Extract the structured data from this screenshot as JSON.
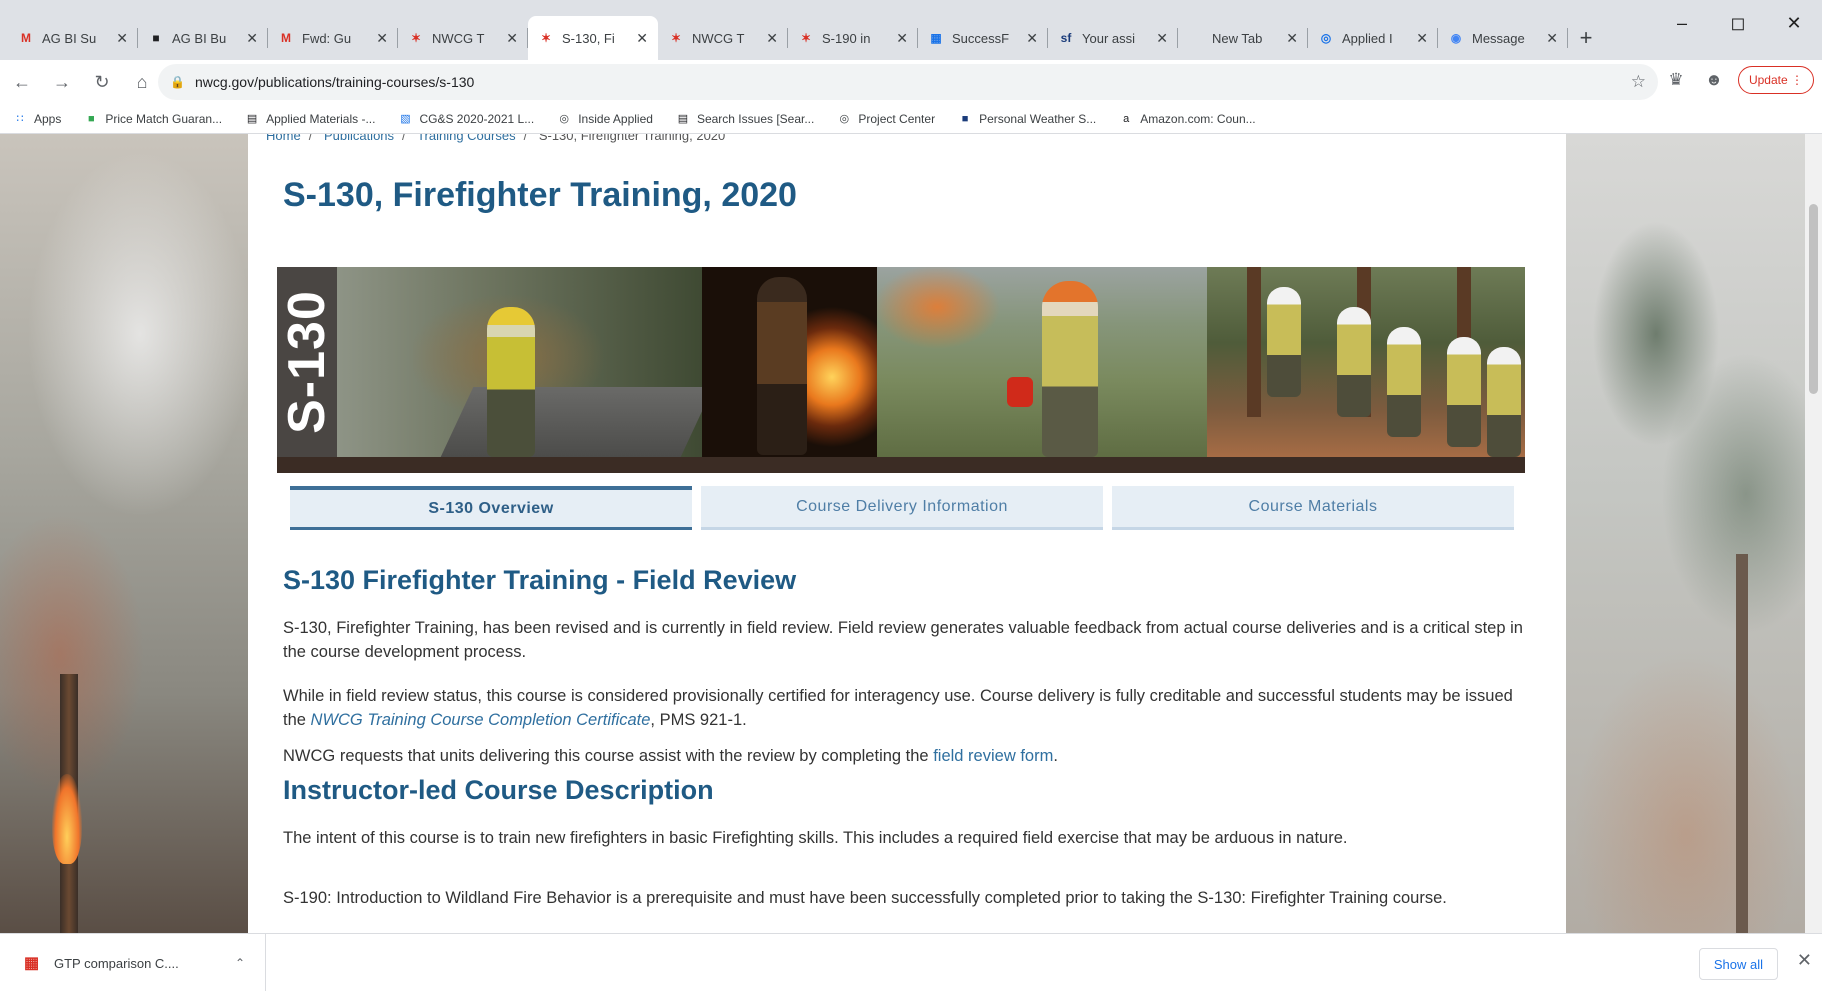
{
  "browser": {
    "tabs": [
      {
        "title": "AG BI Su",
        "icon": "gmail-icon",
        "fav": "M",
        "color": "#d93025"
      },
      {
        "title": "AG BI Bu",
        "icon": "doc-icon",
        "fav": "■",
        "color": "#202124"
      },
      {
        "title": "Fwd: Gu",
        "icon": "gmail-icon",
        "fav": "M",
        "color": "#d93025"
      },
      {
        "title": "NWCG T",
        "icon": "nwcg-icon",
        "fav": "✶",
        "color": "#d93025"
      },
      {
        "title": "S-130, Fi",
        "icon": "nwcg-icon",
        "fav": "✶",
        "color": "#d93025",
        "active": true
      },
      {
        "title": "NWCG T",
        "icon": "nwcg-icon",
        "fav": "✶",
        "color": "#d93025"
      },
      {
        "title": "S-190 in",
        "icon": "nwcg-icon",
        "fav": "✶",
        "color": "#d93025"
      },
      {
        "title": "SuccessF",
        "icon": "successfactors-icon",
        "fav": "▦",
        "color": "#1a73e8"
      },
      {
        "title": "Your assi",
        "icon": "sf-icon",
        "fav": "sf",
        "color": "#1a3b7a"
      },
      {
        "title": "New Tab",
        "icon": "",
        "fav": "",
        "color": "#202124"
      },
      {
        "title": "Applied I",
        "icon": "globe-icon",
        "fav": "◎",
        "color": "#1a73e8"
      },
      {
        "title": "Message",
        "icon": "message-icon",
        "fav": "◉",
        "color": "#4285f4"
      }
    ],
    "url": "nwcg.gov/publications/training-courses/s-130",
    "update_label": "Update",
    "bookmarks": [
      {
        "label": "Apps",
        "icon": "apps-icon",
        "glyph": "∷",
        "color": "#1a73e8"
      },
      {
        "label": "Price Match Guaran...",
        "icon": "price-match-icon",
        "glyph": "■",
        "color": "#34a853"
      },
      {
        "label": "Applied Materials -...",
        "icon": "bookmark-icon",
        "glyph": "▤",
        "color": "#202124"
      },
      {
        "label": "CG&S 2020-2021 L...",
        "icon": "bookmark-icon",
        "glyph": "▧",
        "color": "#1a73e8"
      },
      {
        "label": "Inside Applied",
        "icon": "globe-icon",
        "glyph": "◎",
        "color": "#3c4043"
      },
      {
        "label": "Search Issues [Sear...",
        "icon": "bookmark-icon",
        "glyph": "▤",
        "color": "#202124"
      },
      {
        "label": "Project Center",
        "icon": "globe-icon",
        "glyph": "◎",
        "color": "#3c4043"
      },
      {
        "label": "Personal Weather S...",
        "icon": "weather-icon",
        "glyph": "■",
        "color": "#1a3b7a"
      },
      {
        "label": "Amazon.com: Coun...",
        "icon": "amazon-icon",
        "glyph": "a",
        "color": "#202124"
      }
    ]
  },
  "page": {
    "breadcrumb": {
      "home": "Home",
      "pubs": "Publications",
      "courses": "Training Courses",
      "current": "S-130, Firefighter Training, 2020"
    },
    "title": "S-130, Firefighter Training, 2020",
    "banner_label": "S-130",
    "tabs": [
      "S-130 Overview",
      "Course Delivery Information",
      "Course Materials"
    ],
    "sections": {
      "field_review": {
        "heading": "S-130 Firefighter Training - Field Review",
        "p1": "S-130, Firefighter Training, has been revised and is currently in field review. Field review generates valuable feedback from actual course deliveries and is a critical step in the course development process.",
        "p2_a": "While in field review status, this course is considered provisionally certified for interagency use. Course delivery is fully creditable and successful students may be issued the ",
        "p2_link": "NWCG Training Course Completion Certificate",
        "p2_b": ", PMS 921-1.",
        "p3_a": "NWCG requests that units delivering this course assist with the review by completing the ",
        "p3_link": "field review form",
        "p3_b": "."
      },
      "description": {
        "heading": "Instructor-led Course Description",
        "p1": "The intent of this course is to train new firefighters in basic Firefighting skills.  This includes a required field exercise that may be arduous in nature.",
        "p2": "S-190: Introduction to Wildland Fire Behavior is a prerequisite and must have been successfully completed prior to taking the S-130: Firefighter Training  course."
      }
    }
  },
  "downloads": {
    "file": "GTP comparison C....",
    "show_all": "Show all"
  }
}
